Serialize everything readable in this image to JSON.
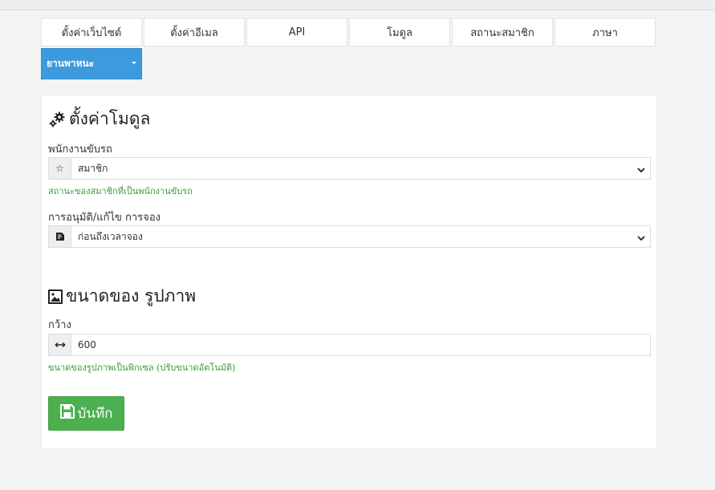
{
  "tabs": [
    {
      "label": "ตั้งค่าเว็บไซต์"
    },
    {
      "label": "ตั้งค่าอีเมล"
    },
    {
      "label": "API"
    },
    {
      "label": "โมดูล"
    },
    {
      "label": "สถานะสมาชิก"
    },
    {
      "label": "ภาษา"
    },
    {
      "label": "ยานพาหนะ",
      "active": true,
      "has_dropdown": true
    }
  ],
  "module_settings": {
    "title": "ตั้งค่าโมดูล",
    "title_icon": "gears-icon",
    "driver": {
      "label": "พนักงานขับรถ",
      "icon": "star-icon",
      "value": "สมาชิก",
      "help": "สถานะของสมาชิกที่เป็นพนักงานขับรถ"
    },
    "booking_approval": {
      "label": "การอนุมัติ/แก้ไข การจอง",
      "icon": "document-edit-icon",
      "value": "ก่อนถึงเวลาจอง"
    }
  },
  "image_size": {
    "title": "ขนาดของ รูปภาพ",
    "title_icon": "image-icon",
    "width": {
      "label": "กว้าง",
      "icon": "horizontal-arrows-icon",
      "value": "600",
      "help": "ขนาดของรูปภาพเป็นพิกเซล (ปรับขนาดอัตโนมัติ)"
    }
  },
  "save_button": {
    "label": "บันทึก",
    "icon": "save-icon"
  },
  "colors": {
    "accent": "#3c9ade",
    "success": "#4caf50",
    "help_text": "#3d9a3d"
  }
}
